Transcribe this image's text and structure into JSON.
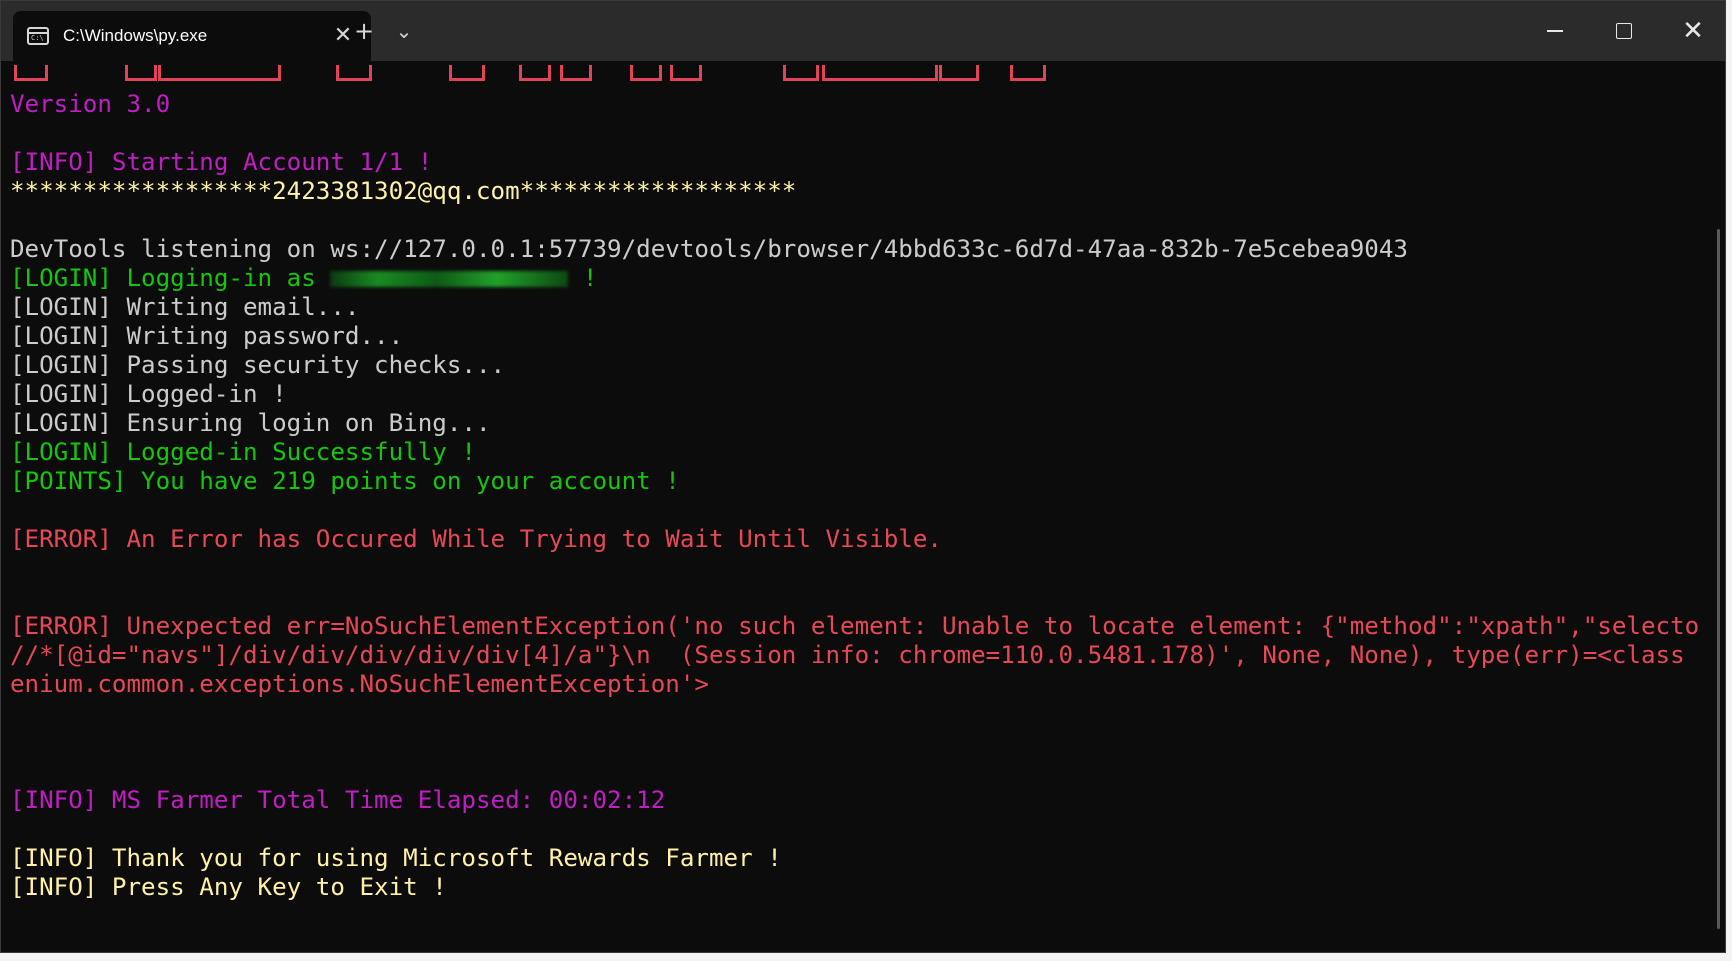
{
  "window": {
    "tab_title": "C:\\Windows\\py.exe",
    "tab_icon": "console-icon",
    "new_tab_glyph": "+",
    "dropdown_glyph": "⌄",
    "close_tab_glyph": "✕",
    "controls": {
      "close_glyph": "✕"
    }
  },
  "console": {
    "version": "Version 3.0",
    "starting": "[INFO] Starting Account 1/1 !",
    "account_banner": "******************2423381302@qq.com*******************",
    "devtools": "DevTools listening on ws://127.0.0.1:57739/devtools/browser/4bbd633c-6d7d-47aa-832b-7e5cebea9043",
    "login_as_prefix": "[LOGIN] Logging-in as ",
    "login_as_suffix": " !",
    "writing_email": "[LOGIN] Writing email...",
    "writing_password": "[LOGIN] Writing password...",
    "security_checks": "[LOGIN] Passing security checks...",
    "logged_in": "[LOGIN] Logged-in !",
    "ensuring_bing": "[LOGIN] Ensuring login on Bing...",
    "logged_in_success": "[LOGIN] Logged-in Successfully !",
    "points": "[POINTS] You have 219 points on your account !",
    "error_wait": "[ERROR] An Error has Occured While Trying to Wait Until Visible.",
    "error_unexpected_1": "[ERROR] Unexpected err=NoSuchElementException('no such element: Unable to locate element: {\"method\":\"xpath\",\"selector\":\"",
    "error_unexpected_2": "//*[@id=\"navs\"]/div/div/div/div/div[4]/a\"}\\n  (Session info: chrome=110.0.5481.178)', None, None), type(err)=<class 'sel",
    "error_unexpected_3": "enium.common.exceptions.NoSuchElementException'>",
    "total_time": "[INFO] MS Farmer Total Time Elapsed: 00:02:12",
    "thank_you": "[INFO] Thank you for using Microsoft Rewards Farmer !",
    "press_key": "[INFO] Press Any Key to Exit !"
  },
  "colors": {
    "info": "#c01ec3",
    "login_success": "#16c60c",
    "error": "#e74856",
    "banner": "#e0445a",
    "highlight": "#fff2a8"
  }
}
